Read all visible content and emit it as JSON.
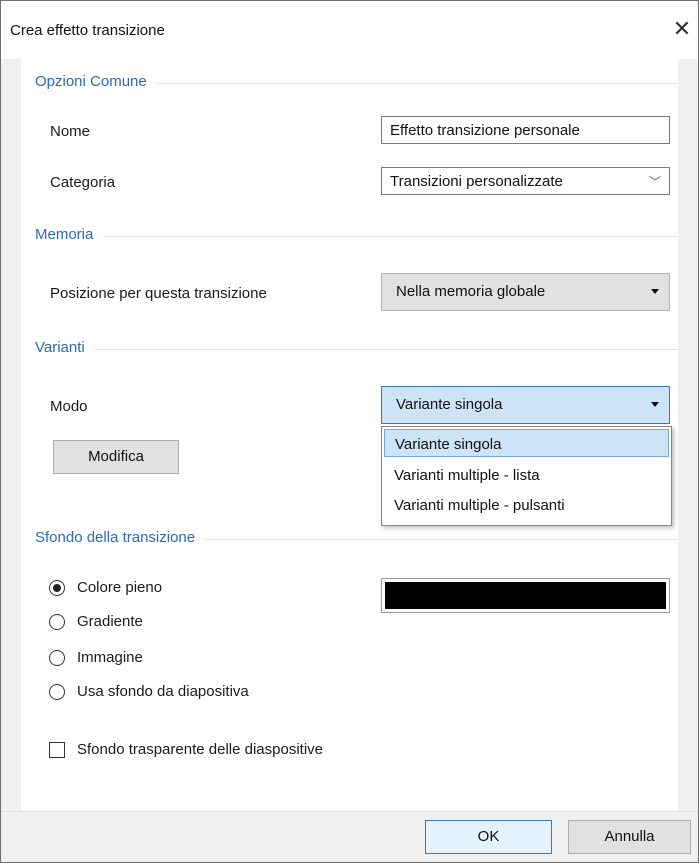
{
  "window": {
    "title": "Crea effetto transizione",
    "close_glyph": "✕"
  },
  "sections": {
    "common": "Opzioni Comune",
    "memory": "Memoria",
    "variants": "Varianti",
    "background": "Sfondo della transizione"
  },
  "fields": {
    "name_label": "Nome",
    "name_value": "Effetto transizione personale",
    "category_label": "Categoria",
    "category_value": "Transizioni personalizzate",
    "position_label": "Posizione per questa transizione",
    "position_value": "Nella memoria globale",
    "mode_label": "Modo",
    "mode_value": "Variante singola"
  },
  "buttons": {
    "edit": "Modifica",
    "ok": "OK",
    "cancel": "Annulla"
  },
  "mode_options": [
    "Variante singola",
    "Varianti multiple - lista",
    "Varianti multiple - pulsanti"
  ],
  "background_options": [
    "Colore pieno",
    "Gradiente",
    "Immagine",
    "Usa sfondo da diapositiva"
  ],
  "background_selected_index": 0,
  "transparent_label": "Sfondo trasparente delle diaspositive",
  "transparent_checked": false,
  "colors": {
    "accent": "#2d6ab0",
    "selected_bg": "#cde4f7",
    "swatch": "#000000"
  },
  "icons": {
    "close": "close-icon",
    "combo": "chevron-down-icon",
    "dropdown": "triangle-down-icon"
  }
}
